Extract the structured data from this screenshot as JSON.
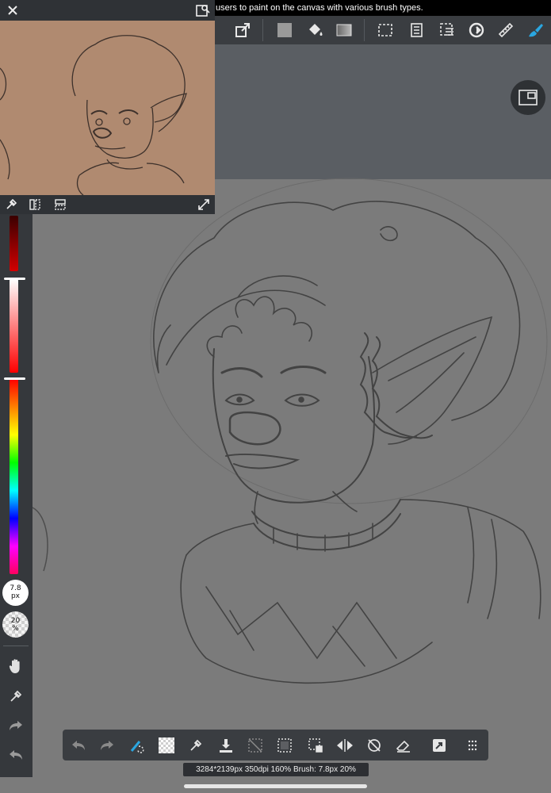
{
  "banner": {
    "text": "users to paint on the canvas with various brush types."
  },
  "status_bar": {
    "text": "3284*2139px 350dpi 160% Brush: 7.8px 20%"
  },
  "brush": {
    "size_value": "7.8",
    "size_unit": "px",
    "opacity_value": "20",
    "opacity_unit": "%"
  },
  "colors": {
    "toolbar": "#3a3d41",
    "navigator_bg": "#b08a70",
    "canvas": "#7b7b7b",
    "accent": "#2aa6e0"
  },
  "toolbar_icons": [
    "transform-icon",
    "fill-color-icon",
    "bucket-icon",
    "gradient-icon",
    "selection-icon",
    "layer-icon",
    "select-layer-icon",
    "rotate-icon",
    "ruler-icon",
    "brush-icon"
  ],
  "bottom_icons": [
    "undo-icon",
    "redo-icon",
    "lasso-fill-icon",
    "transparent-icon",
    "eyedropper-icon",
    "save-icon",
    "deselect-icon",
    "select-all-icon",
    "transform-icon",
    "flip-icon",
    "rotate-reset-icon",
    "eraser-icon",
    "share-icon",
    "menu-icon"
  ]
}
